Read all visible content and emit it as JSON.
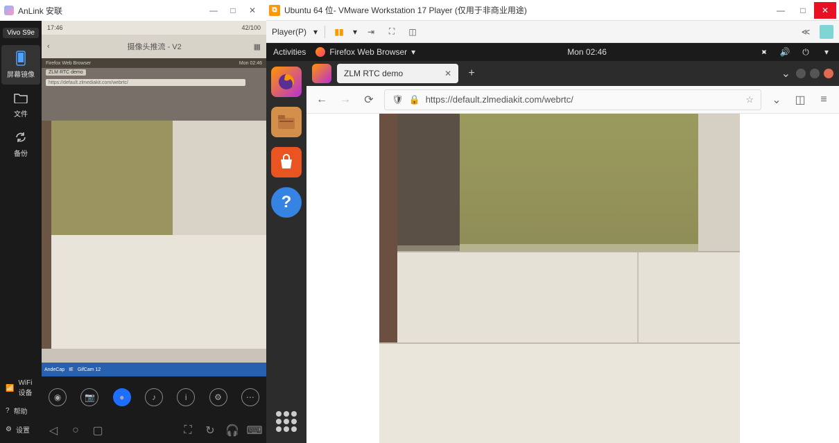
{
  "anlink": {
    "title": "AnLink 安联",
    "device": "Vivo S9e",
    "sidebar": [
      {
        "id": "mirror",
        "label": "屏幕镜像"
      },
      {
        "id": "files",
        "label": "文件"
      },
      {
        "id": "backup",
        "label": "备份"
      }
    ],
    "lower": [
      {
        "id": "wifi",
        "label": "WiFi设备"
      },
      {
        "id": "help",
        "label": "帮助"
      },
      {
        "id": "settings",
        "label": "设置"
      }
    ],
    "phone": {
      "clock": "17:46",
      "battery": "42/100",
      "app_title": "摄像头推流 - V2",
      "mini_browser": "Firefox Web Browser",
      "mini_time": "Mon 02:46",
      "mini_tab": "ZLM RTC demo",
      "mini_url": "https://default.zlmediakit.com/webrtc/",
      "taskbar_items": [
        "AndeCap",
        "IE",
        "GifCam 12"
      ]
    }
  },
  "vmware": {
    "title": "Ubuntu 64 位- VMware Workstation 17 Player (仅用于非商业用途)",
    "player_menu": "Player(P)",
    "ubuntu": {
      "activities": "Activities",
      "app": "Firefox Web Browser",
      "clock": "Mon 02:46"
    },
    "browser": {
      "tab": "ZLM RTC demo",
      "url": "https://default.zlmediakit.com/webrtc/"
    }
  }
}
